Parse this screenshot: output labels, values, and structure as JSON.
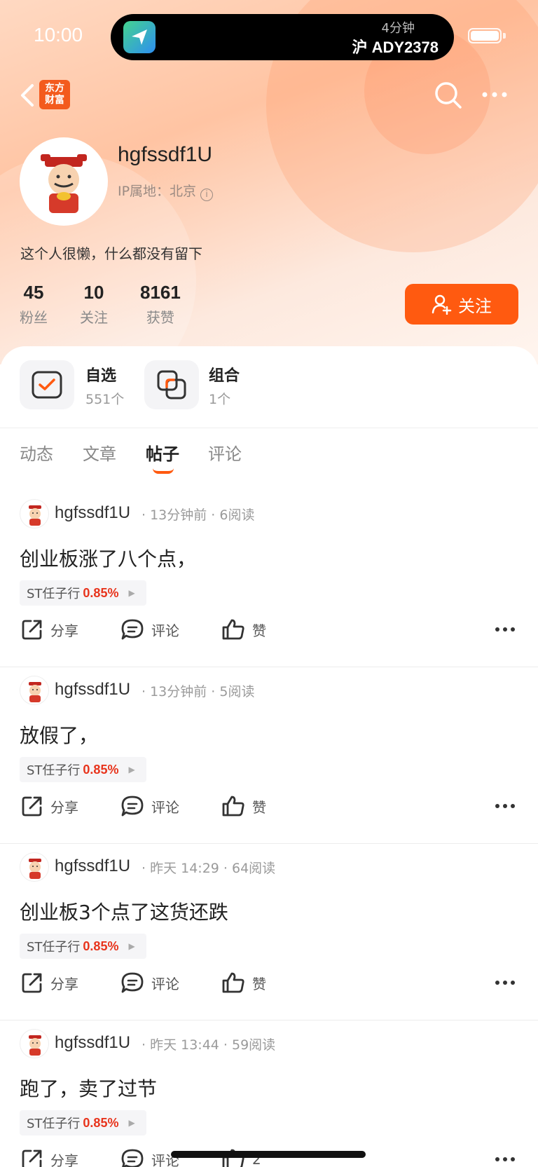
{
  "status_bar": {
    "time": "10:00",
    "island_top": "4分钟",
    "island_bottom": "沪 ADY2378"
  },
  "nav": {
    "brand_line1": "东方",
    "brand_line2": "财富"
  },
  "profile": {
    "username": "hgfssdf1U",
    "ip_location": "IP属地：北京",
    "bio": "这个人很懒，什么都没有留下",
    "stats": [
      {
        "value": "45",
        "label": "粉丝"
      },
      {
        "value": "10",
        "label": "关注"
      },
      {
        "value": "8161",
        "label": "获赞"
      }
    ],
    "follow_label": "关注"
  },
  "collections": [
    {
      "title": "自选",
      "count": "551个"
    },
    {
      "title": "组合",
      "count": "1个"
    }
  ],
  "tabs": [
    "动态",
    "文章",
    "帖子",
    "评论"
  ],
  "active_tab": "帖子",
  "actions": {
    "share": "分享",
    "comment": "评论",
    "like": "赞"
  },
  "posts": [
    {
      "user": "hgfssdf1U",
      "meta": "· 13分钟前 · 6阅读",
      "text": "创业板涨了八个点，",
      "stock": "ST任子行",
      "pct": "0.85%",
      "like": "赞"
    },
    {
      "user": "hgfssdf1U",
      "meta": "· 13分钟前 · 5阅读",
      "text": "放假了，",
      "stock": "ST任子行",
      "pct": "0.85%",
      "like": "赞"
    },
    {
      "user": "hgfssdf1U",
      "meta": "· 昨天 14:29 · 64阅读",
      "text": "创业板3个点了这货还跌",
      "stock": "ST任子行",
      "pct": "0.85%",
      "like": "赞"
    },
    {
      "user": "hgfssdf1U",
      "meta": "· 昨天 13:44 · 59阅读",
      "text": "跑了，卖了过节",
      "stock": "ST任子行",
      "pct": "0.85%",
      "like": "2"
    }
  ],
  "colors": {
    "accent": "#ff5a10",
    "stock_up": "#e8341c"
  }
}
